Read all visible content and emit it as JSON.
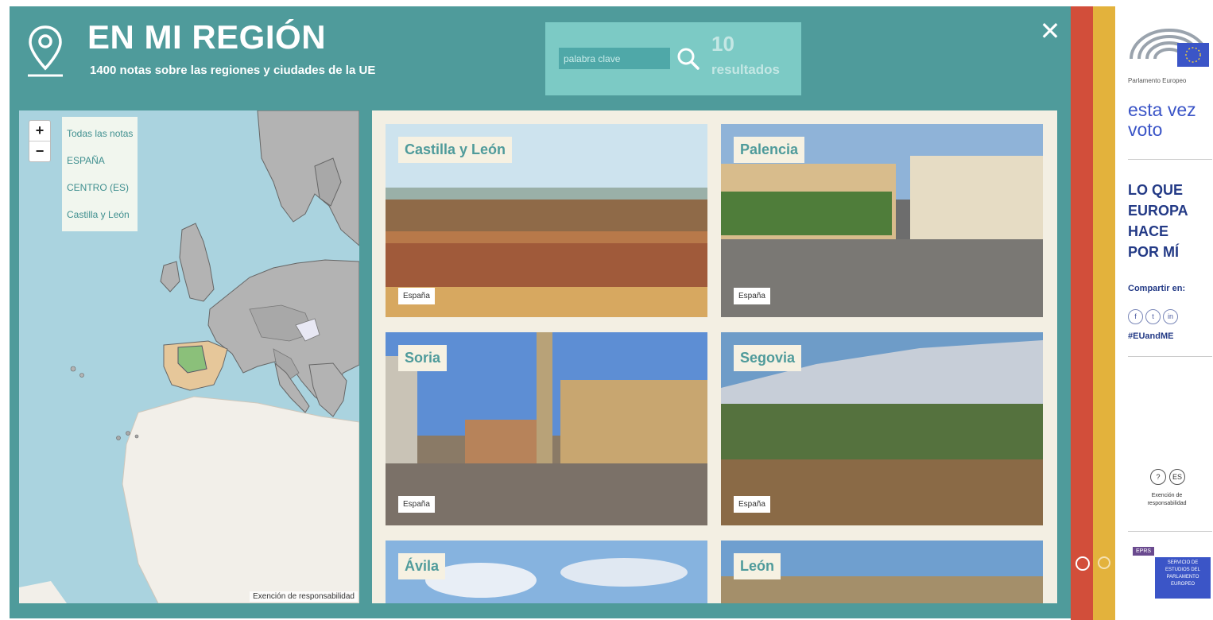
{
  "header": {
    "title": "EN MI REGIÓN",
    "subtitle": "1400 notas sobre las regiones y ciudades de la UE",
    "close_symbol": "✕"
  },
  "search": {
    "placeholder": "palabra clave",
    "count": "10",
    "results_label": "resultados"
  },
  "map": {
    "zoom_in": "+",
    "zoom_out": "−",
    "breadcrumbs": [
      "Todas las notas",
      "ESPAÑA",
      "CENTRO (ES)",
      "Castilla y León"
    ],
    "attribution": "Exención de responsabilidad"
  },
  "cards": [
    {
      "title": "Castilla y León",
      "country": "España"
    },
    {
      "title": "Palencia",
      "country": "España"
    },
    {
      "title": "Soria",
      "country": "España"
    },
    {
      "title": "Segovia",
      "country": "España"
    },
    {
      "title": "Ávila",
      "country": ""
    },
    {
      "title": "León",
      "country": ""
    }
  ],
  "sidebar": {
    "institution": "Parlamento Europeo",
    "campaign_line1": "esta vez",
    "campaign_line2": "voto",
    "headline": [
      "LO QUE",
      "EUROPA",
      "HACE",
      "POR MÍ"
    ],
    "share_label": "Compartir en:",
    "share_icons": [
      "f",
      "t",
      "in"
    ],
    "hashtag": "#EUandME",
    "util_icons": [
      "?",
      "ES"
    ],
    "disclaimer": "Exención de responsabilidad",
    "epsr_tag": "EPRS",
    "epsr_text": "SERVICIO DE ESTUDIOS DEL PARLAMENTO EUROPEO"
  },
  "colors": {
    "teal": "#4f9b9b",
    "search_panel": "#7ccac5",
    "cream": "#f3efe3",
    "red": "#d24e3a",
    "yellow": "#e3b23c",
    "ep_blue": "#3b55c7",
    "navy": "#233a86"
  }
}
